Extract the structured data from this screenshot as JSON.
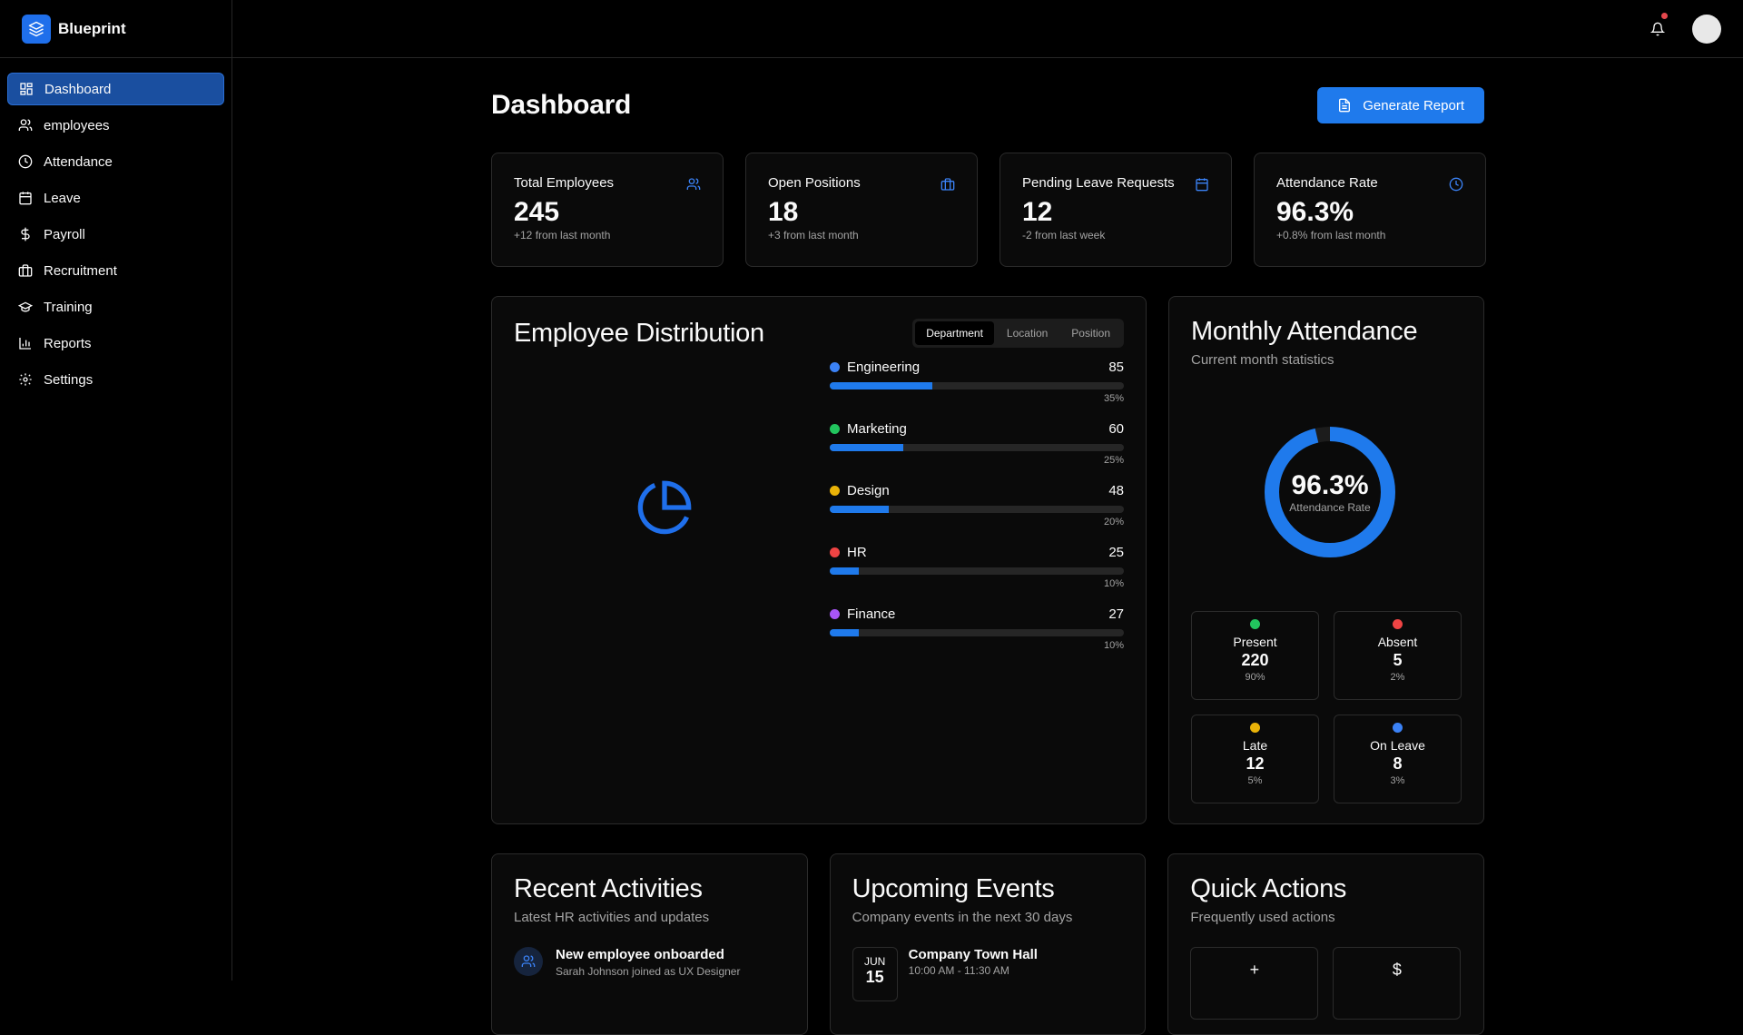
{
  "app": {
    "name": "Blueprint"
  },
  "sidebar": {
    "items": [
      {
        "label": "Dashboard",
        "icon": "grid-icon",
        "active": true
      },
      {
        "label": "employees",
        "icon": "users-icon"
      },
      {
        "label": "Attendance",
        "icon": "clock-icon"
      },
      {
        "label": "Leave",
        "icon": "calendar-icon"
      },
      {
        "label": "Payroll",
        "icon": "dollar-icon"
      },
      {
        "label": "Recruitment",
        "icon": "briefcase-icon"
      },
      {
        "label": "Training",
        "icon": "graduation-cap-icon"
      },
      {
        "label": "Reports",
        "icon": "bar-chart-icon"
      },
      {
        "label": "Settings",
        "icon": "gear-icon"
      }
    ]
  },
  "page": {
    "title": "Dashboard",
    "action_label": "Generate Report"
  },
  "stats": [
    {
      "label": "Total Employees",
      "value": "245",
      "sub": "+12 from last month",
      "icon": "users-icon"
    },
    {
      "label": "Open Positions",
      "value": "18",
      "sub": "+3 from last month",
      "icon": "briefcase-icon"
    },
    {
      "label": "Pending Leave Requests",
      "value": "12",
      "sub": "-2 from last week",
      "icon": "calendar-icon"
    },
    {
      "label": "Attendance Rate",
      "value": "96.3%",
      "sub": "+0.8% from last month",
      "icon": "clock-icon"
    }
  ],
  "distribution": {
    "title": "Employee Distribution",
    "tabs": [
      "Department",
      "Location",
      "Position"
    ],
    "active_tab": "Department",
    "departments": [
      {
        "name": "Engineering",
        "count": "85",
        "pct": "35%",
        "share": 0.35,
        "color": "#3b82f6"
      },
      {
        "name": "Marketing",
        "count": "60",
        "pct": "25%",
        "share": 0.25,
        "color": "#22c55e"
      },
      {
        "name": "Design",
        "count": "48",
        "pct": "20%",
        "share": 0.2,
        "color": "#eab308"
      },
      {
        "name": "HR",
        "count": "25",
        "pct": "10%",
        "share": 0.1,
        "color": "#ef4444"
      },
      {
        "name": "Finance",
        "count": "27",
        "pct": "10%",
        "share": 0.1,
        "color": "#a855f7"
      }
    ]
  },
  "attendance": {
    "title": "Monthly Attendance",
    "subtitle": "Current month statistics",
    "rate": "96.3%",
    "rate_value": 0.963,
    "rate_label": "Attendance Rate",
    "boxes": [
      {
        "name": "Present",
        "value": "220",
        "pct": "90%",
        "color": "#22c55e"
      },
      {
        "name": "Absent",
        "value": "5",
        "pct": "2%",
        "color": "#ef4444"
      },
      {
        "name": "Late",
        "value": "12",
        "pct": "5%",
        "color": "#eab308"
      },
      {
        "name": "On Leave",
        "value": "8",
        "pct": "3%",
        "color": "#3b82f6"
      }
    ]
  },
  "activities": {
    "title": "Recent Activities",
    "subtitle": "Latest HR activities and updates",
    "items": [
      {
        "title": "New employee onboarded",
        "desc": "Sarah Johnson joined as UX Designer"
      }
    ]
  },
  "events": {
    "title": "Upcoming Events",
    "subtitle": "Company events in the next 30 days",
    "items": [
      {
        "month": "JUN",
        "day": "15",
        "title": "Company Town Hall",
        "time": "10:00 AM - 11:30 AM"
      }
    ]
  },
  "quick_actions": {
    "title": "Quick Actions",
    "subtitle": "Frequently used actions",
    "buttons": [
      {
        "glyph": "+"
      },
      {
        "glyph": "$"
      }
    ]
  }
}
